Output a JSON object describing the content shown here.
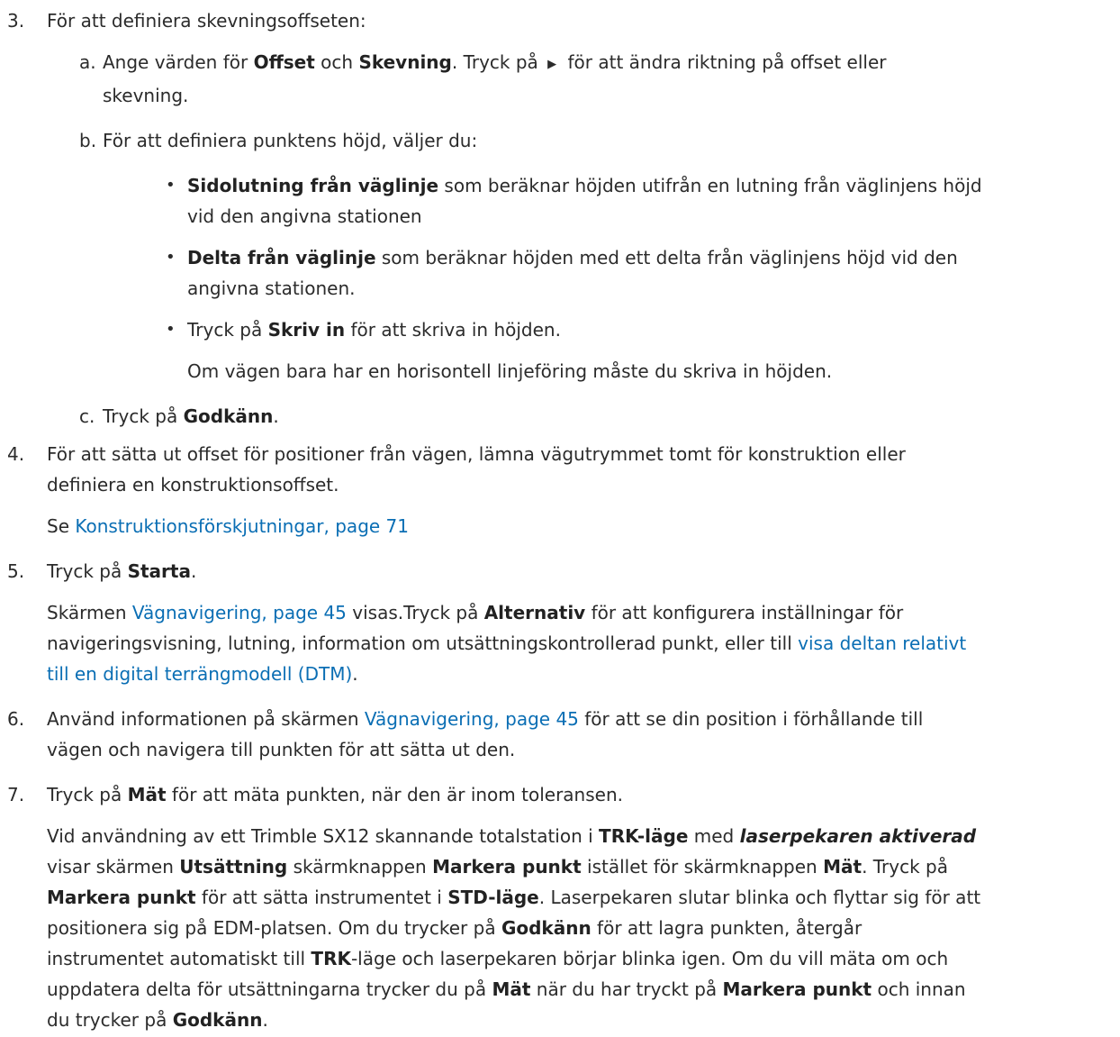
{
  "steps": {
    "s3": {
      "num": "3.",
      "text": "För att definiera skevningsoffseten:",
      "a": {
        "label": "a.",
        "t1": "Ange värden för ",
        "b1": "Offset",
        "t2": " och ",
        "b2": "Skevning",
        "t3": ". Tryck på ",
        "icon": "play-triangle-icon",
        "t4": " för att ändra riktning på offset eller",
        "t5": "skevning."
      },
      "b": {
        "label": "b.",
        "text": "För att definiera punktens höjd, väljer du:",
        "bullets": [
          {
            "bold": "Sidolutning från väglinje",
            "l1": " som beräknar höjden utifrån en lutning från väglinjens höjd",
            "l2": "vid den angivna stationen"
          },
          {
            "bold": "Delta från väglinje",
            "l1": " som beräknar höjden med ett delta från väglinjens höjd vid den",
            "l2": "angivna stationen."
          },
          {
            "pre": "Tryck på ",
            "bold": "Skriv in",
            "post": " för att skriva in höjden."
          }
        ],
        "note": "Om vägen bara har en horisontell linjeföring måste du skriva in höjden."
      },
      "c": {
        "label": "c.",
        "t1": "Tryck på ",
        "b1": "Godkänn",
        "t2": "."
      }
    },
    "s4": {
      "num": "4.",
      "l1": "För att sätta ut offset för positioner från vägen, lämna vägutrymmet tomt för konstruktion eller",
      "l2": "definiera en konstruktionsoffset.",
      "see": "Se ",
      "link": "Konstruktionsförskjutningar, page 71"
    },
    "s5": {
      "num": "5.",
      "t1": "Tryck på ",
      "b1": "Starta",
      "t2": ".",
      "p_pre": "Skärmen ",
      "p_link": "Vägnavigering, page 45",
      "p_mid": " visas.Tryck på ",
      "p_bold": "Alternativ",
      "p_post": " för att konfigurera inställningar för",
      "p_l2": "navigeringsvisning, lutning, information om utsättningskontrollerad punkt, eller till ",
      "p_link2a": "visa deltan relativt",
      "p_link2b": "till en digital terrängmodell (DTM)",
      "p_end": "."
    },
    "s6": {
      "num": "6.",
      "t1": "Använd informationen på skärmen ",
      "link": "Vägnavigering, page 45",
      "t2": " för att se din position i förhållande till",
      "l2": "vägen och navigera till punkten för att sätta ut den."
    },
    "s7": {
      "num": "7.",
      "t1": "Tryck på ",
      "b1": "Mät",
      "t2": " för att mäta punkten, när den är inom toleransen.",
      "p": {
        "a1": "Vid användning av ett Trimble SX12 skannande totalstation i ",
        "a2": "TRK-läge",
        "a3": " med ",
        "a4": "laserpekaren aktiverad",
        "b1": "visar skärmen ",
        "b2": "Utsättning",
        "b3": " skärmknappen ",
        "b4": "Markera punkt",
        "b5": " istället för skärmknappen ",
        "b6": "Mät",
        "b7": ". Tryck på",
        "c1": "Markera punkt",
        "c2": " för att sätta instrumentet i ",
        "c3": "STD-läge",
        "c4": ". Laserpekaren slutar blinka och flyttar sig för att",
        "d1": "positionera sig på EDM-platsen. Om du trycker på ",
        "d2": "Godkänn",
        "d3": " för att lagra punkten, återgår",
        "e1": "instrumentet automatiskt till ",
        "e2": "TRK",
        "e3": "-läge och laserpekaren börjar blinka igen. Om du vill mäta om och",
        "f1": "uppdatera delta för utsättningarna trycker du på ",
        "f2": "Mät",
        "f3": " när du har tryckt på ",
        "f4": "Markera punkt",
        "f5": " och innan",
        "g1": "du trycker på ",
        "g2": "Godkänn",
        "g3": "."
      }
    }
  }
}
